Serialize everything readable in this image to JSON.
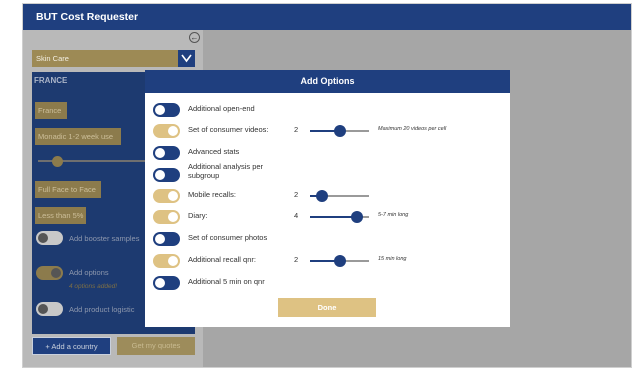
{
  "app": {
    "title": "BUT Cost Requester"
  },
  "sidebar": {
    "category_dropdown": {
      "selected": "Skin Care"
    },
    "country_panel": {
      "title": "FRANCE",
      "fields": [
        "France",
        "Monadic 1-2 week use",
        "",
        "Full Face to Face",
        "Less than 5%"
      ],
      "slider_level": 0.18,
      "toggles": [
        {
          "label": "Add booster samples",
          "on": false
        },
        {
          "label": "Add options",
          "on": true,
          "sub": "4 options added!"
        },
        {
          "label": "Add product logistic",
          "on": false
        }
      ]
    },
    "add_country_label": "+ Add a country",
    "get_quotes_label": "Get my quotes"
  },
  "modal": {
    "title": "Add Options",
    "options": [
      {
        "label": "Additional open-end",
        "on": false
      },
      {
        "label": "Set of consumer videos:",
        "on": true,
        "value": "2",
        "level": 0.5,
        "note": "Maximum 20 videos per cell"
      },
      {
        "label": "Advanced stats",
        "on": false
      },
      {
        "label": "Additional analysis per subgroup",
        "on": false
      },
      {
        "label": "Mobile recalls:",
        "on": true,
        "value": "2",
        "level": 0.2
      },
      {
        "label": "Diary:",
        "on": true,
        "value": "4",
        "level": 0.8,
        "note": "5-7 min long"
      },
      {
        "label": "Set of consumer photos",
        "on": false
      },
      {
        "label": "Additional recall qnr:",
        "on": true,
        "value": "2",
        "level": 0.5,
        "note": "15 min long"
      },
      {
        "label": "Additional 5 min on qnr",
        "on": false
      }
    ],
    "done_label": "Done"
  },
  "colors": {
    "navy": "#1f3f7f",
    "gold": "#dec283",
    "overlay": "#a6a6a6"
  },
  "icons": [
    "collapse-icon",
    "chevron-down-icon"
  ]
}
